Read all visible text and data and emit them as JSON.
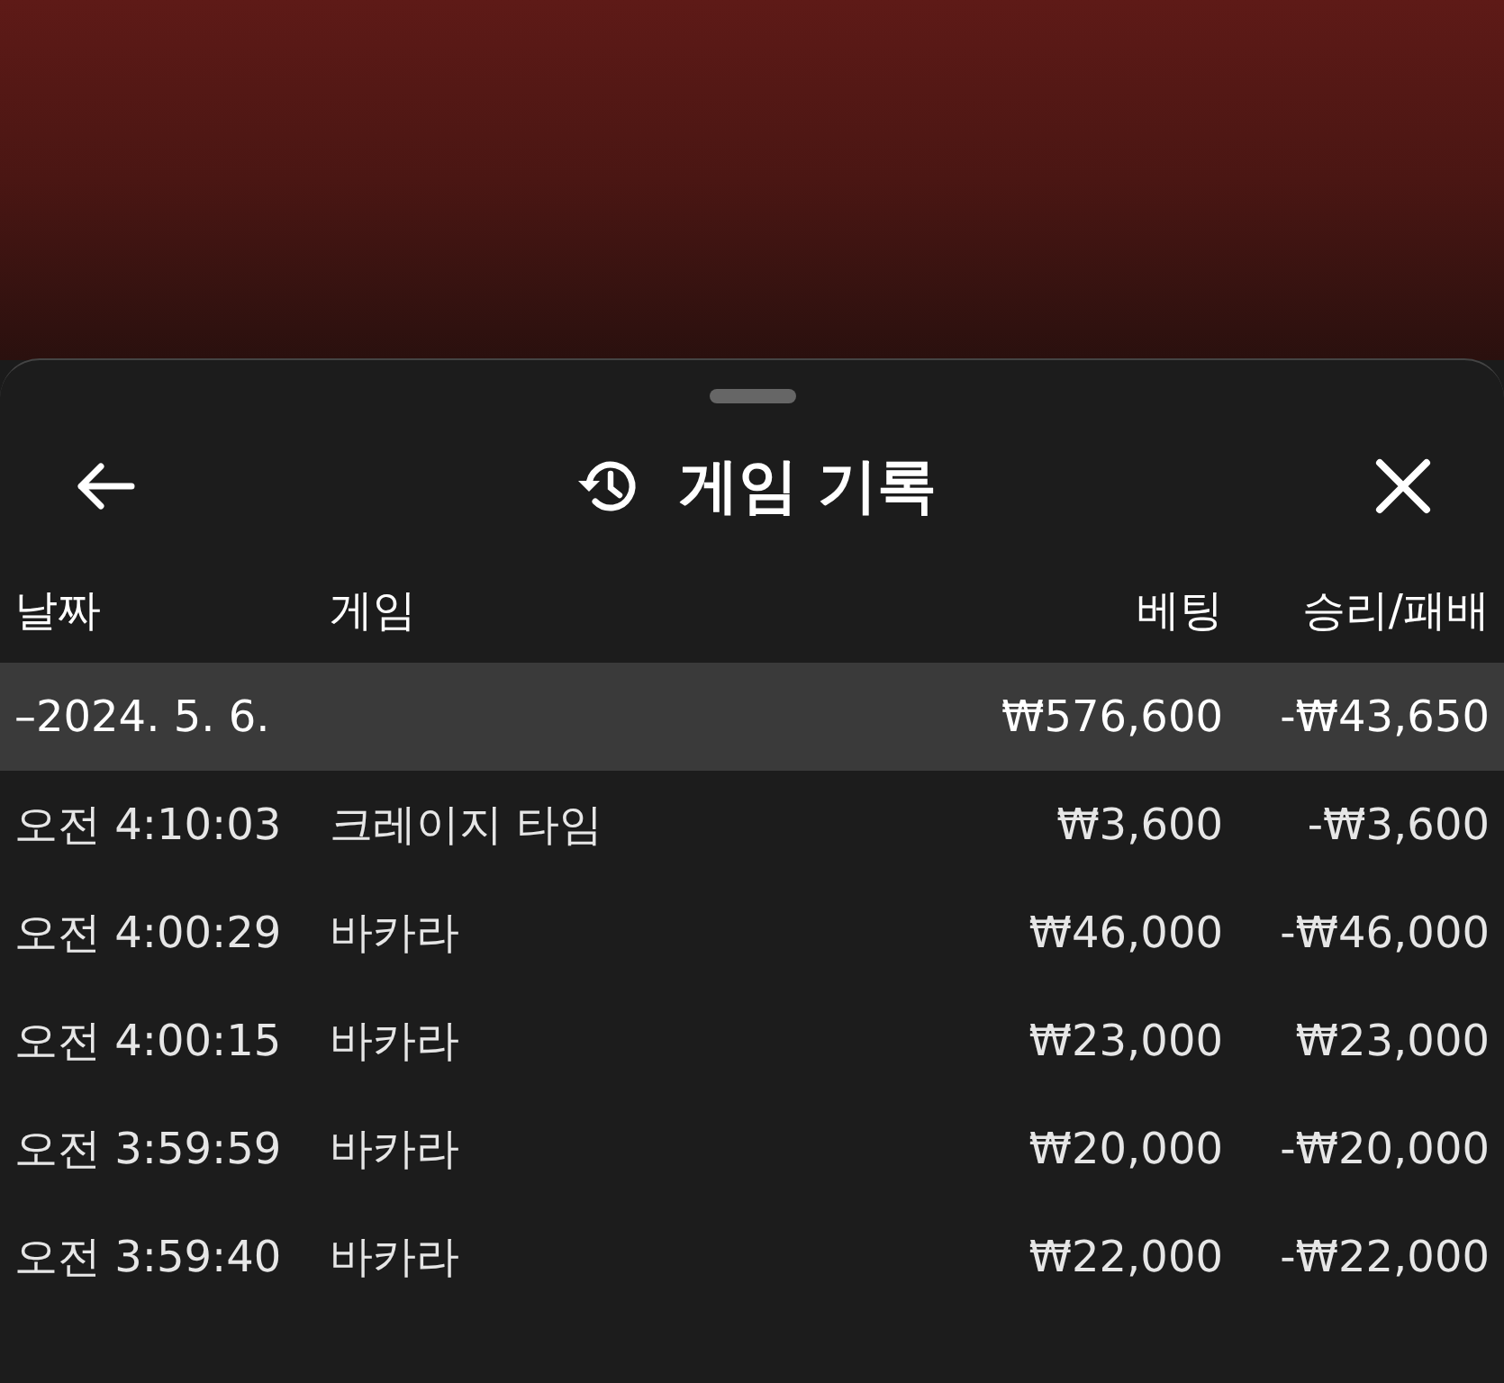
{
  "header": {
    "title": "게임 기록"
  },
  "columns": [
    "날짜",
    "게임",
    "베팅",
    "승리/패배"
  ],
  "group": {
    "date": "–2024. 5. 6.",
    "bet": "₩576,600",
    "result": "-₩43,650"
  },
  "rows": [
    {
      "time": "오전 4:10:03",
      "game": "크레이지 타임",
      "bet": "₩3,600",
      "result": "-₩3,600"
    },
    {
      "time": "오전 4:00:29",
      "game": "바카라",
      "bet": "₩46,000",
      "result": "-₩46,000"
    },
    {
      "time": "오전 4:00:15",
      "game": "바카라",
      "bet": "₩23,000",
      "result": "₩23,000"
    },
    {
      "time": "오전 3:59:59",
      "game": "바카라",
      "bet": "₩20,000",
      "result": "-₩20,000"
    },
    {
      "time": "오전 3:59:40",
      "game": "바카라",
      "bet": "₩22,000",
      "result": "-₩22,000"
    }
  ]
}
